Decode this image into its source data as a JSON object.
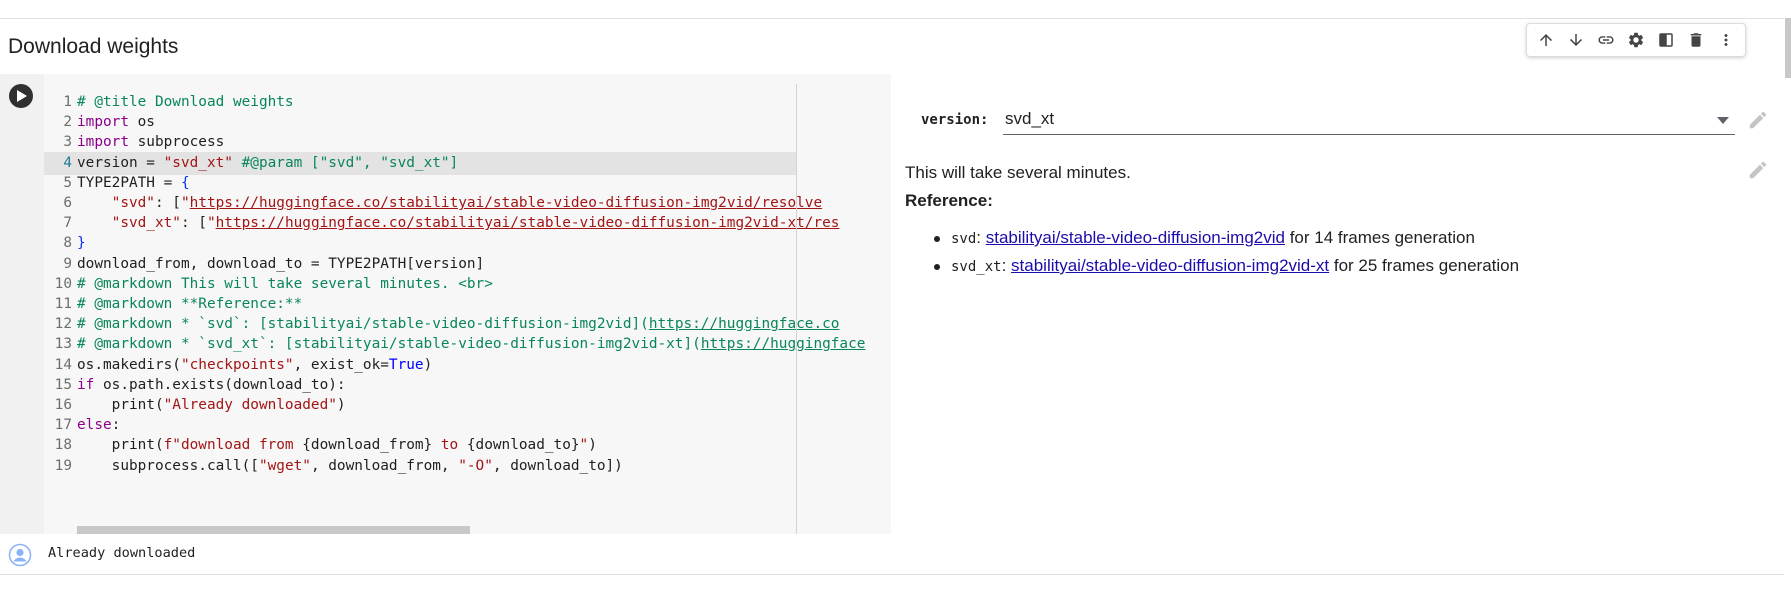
{
  "cell": {
    "title": "Download weights"
  },
  "toolbar": {
    "buttons": [
      {
        "name": "move-up",
        "icon": "arrow-up-icon"
      },
      {
        "name": "move-down",
        "icon": "arrow-down-icon"
      },
      {
        "name": "copy-link",
        "icon": "link-icon"
      },
      {
        "name": "settings",
        "icon": "gear-icon"
      },
      {
        "name": "mirror",
        "icon": "mirror-icon"
      },
      {
        "name": "delete",
        "icon": "trash-icon"
      },
      {
        "name": "more",
        "icon": "more-vert-icon"
      }
    ]
  },
  "code": {
    "lines": [
      {
        "n": "1",
        "html": "<span style=\"color:#098658\"># @title Download weights</span>"
      },
      {
        "n": "2",
        "html": "<span style=\"color:#8b008b\">import</span> os"
      },
      {
        "n": "3",
        "html": "<span style=\"color:#8b008b\">import</span> subprocess"
      },
      {
        "n": "4",
        "html": "version = <span style=\"color:#a31515\">\"svd_xt\"</span> <span style=\"color:#098658\">#@param [\"svd\", \"svd_xt\"]</span>",
        "current": true
      },
      {
        "n": "5",
        "html": "TYPE2PATH = <span style=\"color:#0431fa\">{</span>"
      },
      {
        "n": "6",
        "html": "    <span style=\"color:#a31515\">\"svd\"</span>: [<span style=\"color:#a31515\">\"<u>https://huggingface.co/stabilityai/stable-video-diffusion-img2vid/resolve</u></span>"
      },
      {
        "n": "7",
        "html": "    <span style=\"color:#a31515\">\"svd_xt\"</span>: [<span style=\"color:#a31515\">\"<u>https://huggingface.co/stabilityai/stable-video-diffusion-img2vid-xt/res</u></span>"
      },
      {
        "n": "8",
        "html": "<span style=\"color:#0431fa\">}</span>"
      },
      {
        "n": "9",
        "html": "download_from, download_to = TYPE2PATH[version]"
      },
      {
        "n": "10",
        "html": "<span style=\"color:#098658\"># @markdown This will take several minutes. &lt;br&gt;</span>"
      },
      {
        "n": "11",
        "html": "<span style=\"color:#098658\"># @markdown **Reference:**</span>"
      },
      {
        "n": "12",
        "html": "<span style=\"color:#098658\"># @markdown * `svd`: [stabilityai/stable-video-diffusion-img2vid](<u>https://huggingface.co</u></span>"
      },
      {
        "n": "13",
        "html": "<span style=\"color:#098658\"># @markdown * `svd_xt`: [stabilityai/stable-video-diffusion-img2vid-xt](<u>https://huggingface</u></span>"
      },
      {
        "n": "14",
        "html": "os.makedirs(<span style=\"color:#a31515\">\"checkpoints\"</span>, exist_ok=<span style=\"color:#0000ff\">True</span>)"
      },
      {
        "n": "15",
        "html": "<span style=\"color:#8b008b\">if</span> os.path.exists(download_to):"
      },
      {
        "n": "16",
        "html": "    print(<span style=\"color:#a31515\">\"Already downloaded\"</span>)"
      },
      {
        "n": "17",
        "html": "<span style=\"color:#8b008b\">else</span>:"
      },
      {
        "n": "18",
        "html": "    print(<span style=\"color:#a31515\">f\"download from </span>{download_from}<span style=\"color:#a31515\"> to </span>{download_to}<span style=\"color:#a31515\">\"</span>)"
      },
      {
        "n": "19",
        "html": "    subprocess.call([<span style=\"color:#a31515\">\"wget\"</span>, download_from, <span style=\"color:#a31515\">\"-O\"</span>, download_to])"
      }
    ]
  },
  "form": {
    "param_label": "version:",
    "selected": "svd_xt"
  },
  "markdown": {
    "text": "This will take several minutes.",
    "reference": "Reference:",
    "items": [
      {
        "code": "svd",
        "link": "stabilityai/stable-video-diffusion-img2vid",
        "suffix": " for 14 frames generation"
      },
      {
        "code": "svd_xt",
        "link": "stabilityai/stable-video-diffusion-img2vid-xt",
        "suffix": " for 25 frames generation"
      }
    ]
  },
  "output": {
    "text": "Already downloaded"
  }
}
